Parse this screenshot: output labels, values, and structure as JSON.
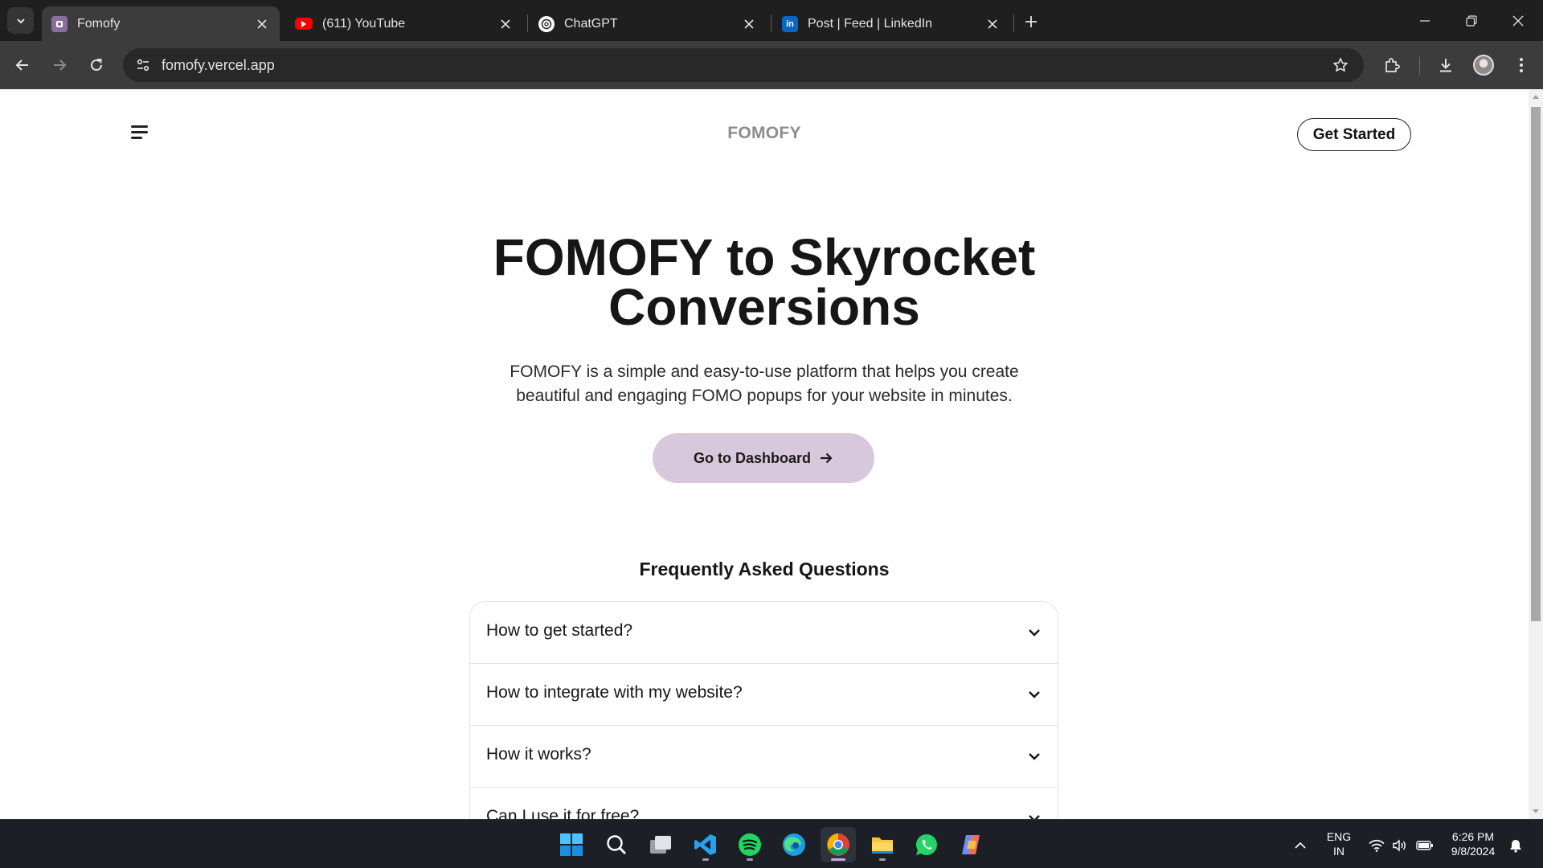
{
  "browser": {
    "tabs": [
      {
        "title": "Fomofy",
        "favicon": "fomofy-icon",
        "active": true
      },
      {
        "title": "(611) YouTube",
        "favicon": "youtube-icon",
        "active": false
      },
      {
        "title": "ChatGPT",
        "favicon": "chatgpt-icon",
        "active": false
      },
      {
        "title": "Post | Feed | LinkedIn",
        "favicon": "linkedin-icon",
        "active": false
      }
    ],
    "url": "fomofy.vercel.app"
  },
  "header": {
    "brand": "FOMOFY",
    "cta_label": "Get Started"
  },
  "hero": {
    "title_line1": "FOMOFY to Skyrocket",
    "title_line2": "Conversions",
    "description": "FOMOFY is a simple and easy-to-use platform that helps you create beautiful and engaging FOMO popups for your website in minutes.",
    "button_label": "Go to Dashboard"
  },
  "faq": {
    "heading": "Frequently Asked Questions",
    "items": [
      {
        "question": "How to get started?"
      },
      {
        "question": "How to integrate with my website?"
      },
      {
        "question": "How it works?"
      },
      {
        "question": "Can I use it for free?"
      }
    ]
  },
  "taskbar": {
    "apps": [
      "start-icon",
      "search-icon",
      "task-view-icon",
      "vscode-icon",
      "spotify-icon",
      "edge-icon",
      "chrome-icon",
      "file-explorer-icon",
      "whatsapp-icon",
      "copilot-icon"
    ],
    "language_line1": "ENG",
    "language_line2": "IN",
    "time": "6:26 PM",
    "date": "9/8/2024"
  },
  "colors": {
    "tabbar": "#1f1f1f",
    "toolbar": "#3c3c3c",
    "dashboard_button": "#d8c8dc",
    "brand_text": "#8c8c90"
  }
}
